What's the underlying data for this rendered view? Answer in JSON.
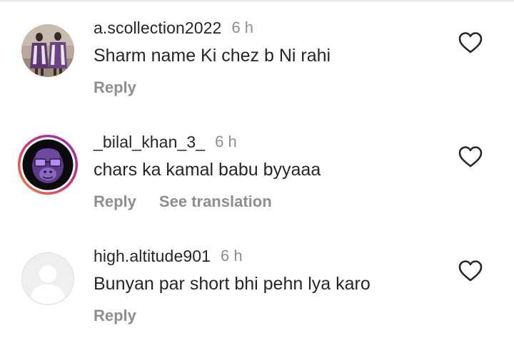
{
  "comments": [
    {
      "username": "a.scollection2022",
      "time": "6 h",
      "text": "Sharm name Ki chez b Ni rahi",
      "reply_label": "Reply",
      "avatar_icon": "photo-avatar",
      "like_icon": "heart-outline-icon"
    },
    {
      "username": "_bilal_khan_3_",
      "time": "6 h",
      "text": "chars ka kamal babu byyaaa",
      "reply_label": "Reply",
      "translate_label": "See translation",
      "avatar_icon": "gorilla-avatar-with-story-ring",
      "like_icon": "heart-outline-icon"
    },
    {
      "username": "high.altitude901",
      "time": "6 h",
      "text": "Bunyan par short bhi pehn lya karo",
      "reply_label": "Reply",
      "avatar_icon": "default-user-avatar",
      "like_icon": "heart-outline-icon"
    }
  ],
  "colors": {
    "text_primary": "#262626",
    "text_secondary": "#8e8e8e",
    "story_ring_start": "#f58529",
    "story_ring_mid": "#dd2a7b",
    "story_ring_end": "#8134af"
  }
}
